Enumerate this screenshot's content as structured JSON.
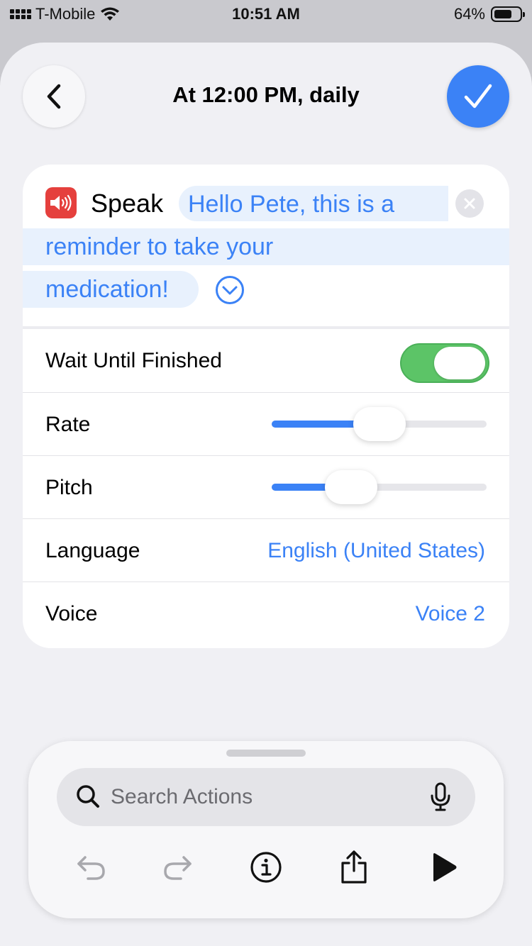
{
  "status_bar": {
    "carrier": "T-Mobile",
    "time": "10:51 AM",
    "battery": "64%",
    "icons": [
      "signal-icon",
      "wifi-icon",
      "battery-icon"
    ]
  },
  "nav": {
    "title": "At 12:00 PM, daily",
    "back_icon": "chevron-left-icon",
    "done_icon": "checkmark-icon"
  },
  "action": {
    "icon": "speaker-icon",
    "accent_color": "#e5403d",
    "label": "Speak",
    "text_lines": [
      "Hello Pete, this is a",
      "reminder to take your",
      "medication!"
    ],
    "clear_icon": "clear-icon",
    "expand_icon": "chevron-down-circle-icon"
  },
  "settings": {
    "wait": {
      "label": "Wait Until Finished",
      "on": true
    },
    "rate": {
      "label": "Rate",
      "value": 0.5
    },
    "pitch": {
      "label": "Pitch",
      "value": 0.37
    },
    "language": {
      "label": "Language",
      "value": "English (United States)"
    },
    "voice": {
      "label": "Voice",
      "value": "Voice 2"
    }
  },
  "bottom": {
    "search_placeholder": "Search Actions",
    "toolbar": [
      "undo-icon",
      "redo-icon",
      "info-icon",
      "share-icon",
      "play-icon"
    ]
  },
  "colors": {
    "accent": "#3b82f6",
    "toggle_on": "#5cc467"
  }
}
